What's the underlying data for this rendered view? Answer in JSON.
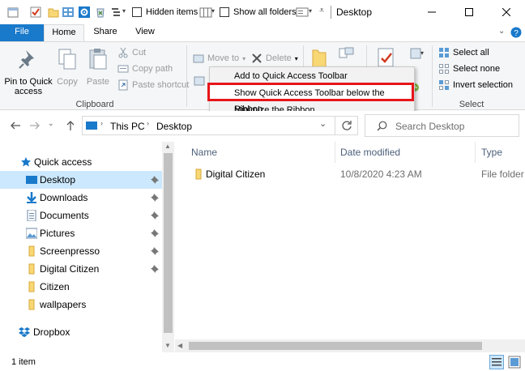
{
  "titlebar": {
    "hidden_items_label": "Hidden items",
    "show_all_folders_label": "Show all folders",
    "window_title": "Desktop"
  },
  "tabs": [
    {
      "label": "File"
    },
    {
      "label": "Home"
    },
    {
      "label": "Share"
    },
    {
      "label": "View"
    }
  ],
  "ribbon": {
    "pin_label_1": "Pin to Quick",
    "pin_label_2": "access",
    "copy_label": "Copy",
    "paste_label": "Paste",
    "cut_label": "Cut",
    "copy_path_label": "Copy path",
    "paste_shortcut_label": "Paste shortcut",
    "clipboard_group": "Clipboard",
    "move_to_label": "Move to",
    "delete_label": "Delete",
    "select_all_label": "Select all",
    "select_none_label": "Select none",
    "invert_selection_label": "Invert selection",
    "select_group": "Select"
  },
  "context_menu": {
    "items": [
      {
        "label": "Add to Quick Access Toolbar"
      },
      {
        "label": "Show Quick Access Toolbar below the Ribbon"
      },
      {
        "label": "Minimize the Ribbon"
      }
    ]
  },
  "address": {
    "location_root": "This PC",
    "location_current": "Desktop",
    "search_placeholder": "Search Desktop"
  },
  "nav_pane": {
    "quick_access_label": "Quick access",
    "items": [
      {
        "label": "Desktop",
        "pinned": true,
        "selected": true
      },
      {
        "label": "Downloads",
        "pinned": true
      },
      {
        "label": "Documents",
        "pinned": true
      },
      {
        "label": "Pictures",
        "pinned": true
      },
      {
        "label": "Screenpresso",
        "pinned": true
      },
      {
        "label": "Digital Citizen",
        "pinned": true
      },
      {
        "label": "Citizen",
        "pinned": false
      },
      {
        "label": "wallpapers",
        "pinned": false
      }
    ],
    "dropbox_label": "Dropbox"
  },
  "content": {
    "columns": [
      "Name",
      "Date modified",
      "Type"
    ],
    "rows": [
      {
        "name": "Digital Citizen",
        "date_modified": "10/8/2020 4:23 AM",
        "type": "File folder"
      }
    ]
  },
  "status": {
    "item_count": "1 item"
  },
  "colors": {
    "accent": "#1979ca",
    "highlight_border": "#e8151a",
    "selection": "#cce8ff",
    "folder": "#f8d775"
  }
}
